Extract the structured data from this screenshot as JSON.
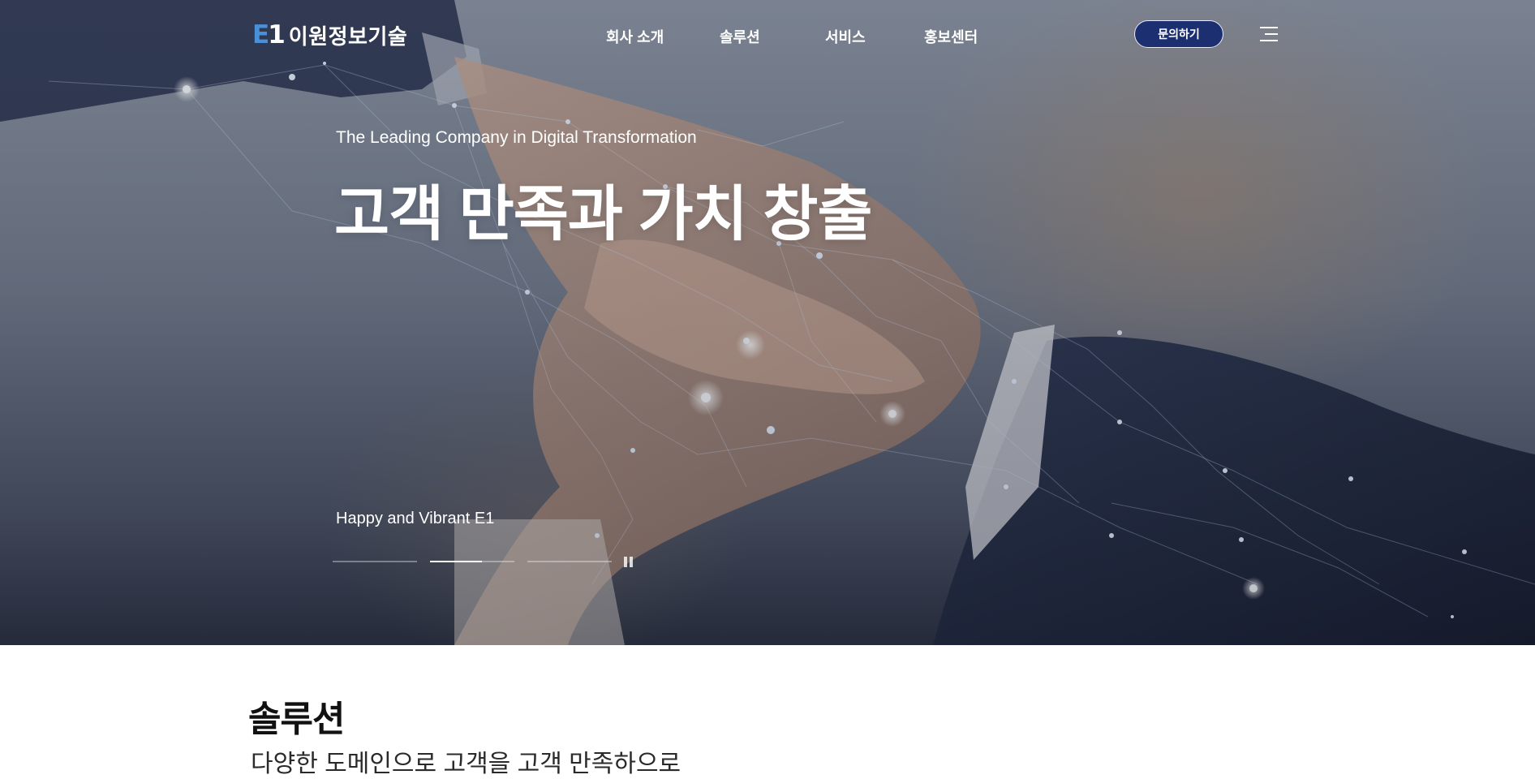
{
  "header": {
    "logo_mark_e": "E",
    "logo_mark_one": "1",
    "logo_text": "이원정보기술",
    "nav": [
      "회사 소개",
      "솔루션",
      "서비스",
      "홍보센터"
    ],
    "inquiry_label": "문의하기",
    "menu_icon": "hamburger-menu-icon"
  },
  "hero": {
    "eyebrow": "The Leading Company in Digital Transformation",
    "title": "고객 만족과 가치 창출",
    "caption": "Happy and Vibrant E1",
    "slides_total": 3,
    "active_slide": 2,
    "active_slide_progress": 0.62,
    "pause_icon": "pause-icon"
  },
  "solutions": {
    "title": "솔루션",
    "subtitle": "다양한 도메인으로 고객을 고객 만족하으로"
  },
  "colors": {
    "brand_blue": "#4a90d9",
    "button_navy": "#1c2f70",
    "white": "#ffffff"
  }
}
